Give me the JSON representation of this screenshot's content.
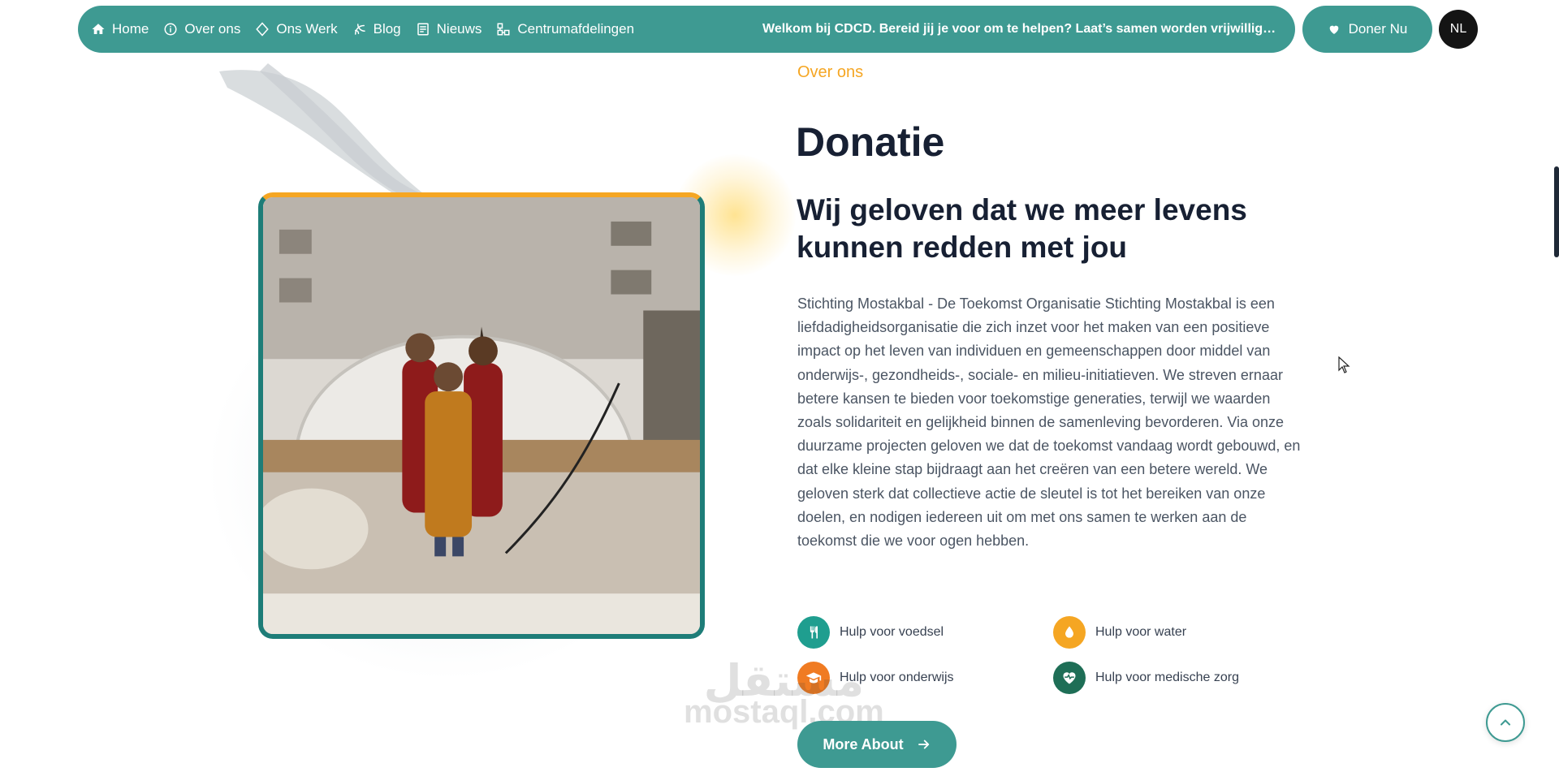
{
  "nav": {
    "items": [
      {
        "label": "Home",
        "icon": "home-icon"
      },
      {
        "label": "Over ons",
        "icon": "info-icon"
      },
      {
        "label": "Ons Werk",
        "icon": "diamond-icon"
      },
      {
        "label": "Blog",
        "icon": "blog-icon"
      },
      {
        "label": "Nieuws",
        "icon": "news-icon"
      },
      {
        "label": "Centrumafdelingen",
        "icon": "departments-icon"
      }
    ],
    "marquee": "Welkom bij CDCD. Bereid jij je voor om te helpen? Laat’s samen worden vrijwilligers...",
    "donate_label": "Doner Nu",
    "language": "NL"
  },
  "about": {
    "eyebrow": "Over ons",
    "title": "Donatie",
    "subtitle": "Wij geloven dat we meer levens kunnen redden met jou",
    "body": "Stichting Mostakbal - De Toekomst Organisatie Stichting Mostakbal is een liefdadigheidsorganisatie die zich inzet voor het maken van een positieve impact op het leven van individuen en gemeenschappen door middel van onderwijs-, gezondheids-, sociale- en milieu-initiatieven. We streven ernaar betere kansen te bieden voor toekomstige generaties, terwijl we waarden zoals solidariteit en gelijkheid binnen de samenleving bevorderen. Via onze duurzame projecten geloven we dat de toekomst vandaag wordt gebouwd, en dat elke kleine stap bijdraagt aan het creëren van een betere wereld. We geloven sterk dat collectieve actie de sleutel is tot het bereiken van onze doelen, en nodigen iedereen uit om met ons samen te werken aan de toekomst die we voor ogen hebben.",
    "features": [
      {
        "label": "Hulp voor voedsel",
        "icon": "fork-knife-icon",
        "color": "#1f9e8f"
      },
      {
        "label": "Hulp voor water",
        "icon": "water-drop-icon",
        "color": "#f5a623"
      },
      {
        "label": "Hulp voor onderwijs",
        "icon": "graduation-cap-icon",
        "color": "#f07b22"
      },
      {
        "label": "Hulp voor medische zorg",
        "icon": "heartbeat-icon",
        "color": "#1e6e56"
      }
    ],
    "cta_label": "More About"
  },
  "watermark": {
    "line1": "مستقل",
    "line2": "mostaql.com"
  },
  "colors": {
    "primary": "#3e9a92",
    "accent": "#f5a623",
    "frame": "#1e7d78",
    "heading": "#172033"
  }
}
